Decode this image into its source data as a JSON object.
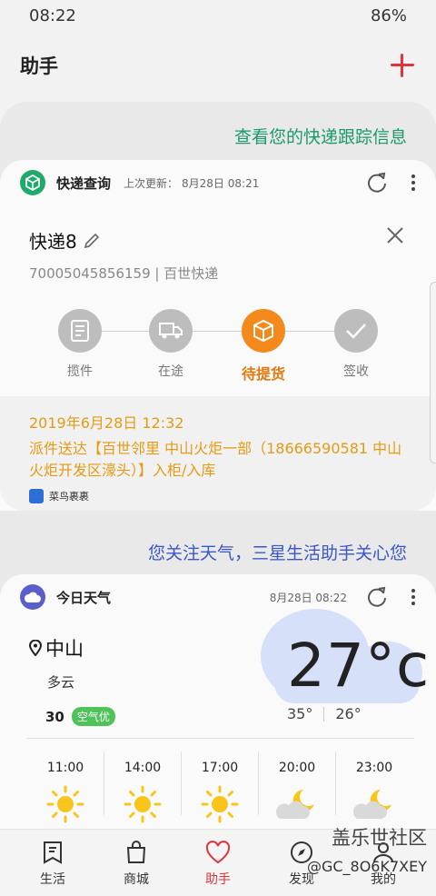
{
  "status": {
    "time": "08:22",
    "battery": "86%"
  },
  "appbar": {
    "title": "助手",
    "add_icon": "plus-icon"
  },
  "express_section": {
    "link": "查看您的快递跟踪信息",
    "card": {
      "name": "快递查询",
      "last_update_label": "上次更新：",
      "last_update": "8月28日 08:21",
      "package_name": "快递8",
      "tracking": "70005045856159 | 百世快递",
      "steps": [
        "揽件",
        "在途",
        "待提货",
        "签收"
      ],
      "current_step": 2,
      "event_time": "2019年6月28日 12:32",
      "event_desc": "派件送达【百世邻里 中山火炬一部（18666590581 中山火炬开发区濠头）】入柜/入库",
      "provider": "菜鸟裹裹"
    }
  },
  "weather_section": {
    "link": "您关注天气，三星生活助手关心您",
    "card": {
      "name": "今日天气",
      "updated": "8月28日 08:22",
      "city": "中山",
      "condition": "多云",
      "aqi_value": "30",
      "aqi_label": "空气优",
      "temp": "27°c",
      "high": "35°",
      "low": "26°",
      "hourly": [
        {
          "time": "11:00",
          "icon": "sun-icon"
        },
        {
          "time": "14:00",
          "icon": "sun-icon"
        },
        {
          "time": "17:00",
          "icon": "sun-icon"
        },
        {
          "time": "20:00",
          "icon": "moon-cloud-icon"
        },
        {
          "time": "23:00",
          "icon": "moon-cloud-icon"
        }
      ]
    }
  },
  "bottom_nav": [
    {
      "label": "生活",
      "icon": "bookmark-icon"
    },
    {
      "label": "商城",
      "icon": "shopping-bag-icon"
    },
    {
      "label": "助手",
      "icon": "heart-icon",
      "active": true
    },
    {
      "label": "发现",
      "icon": "compass-icon"
    },
    {
      "label": "我的",
      "icon": "person-icon"
    }
  ],
  "watermark": {
    "line1": "盖乐世社区",
    "line2": "@GC_8O6K7XEY"
  },
  "colors": {
    "accent_red": "#e0343c",
    "orange": "#f38a1b",
    "green_link": "#1a9a6a",
    "blue_link": "#3a56c8"
  }
}
